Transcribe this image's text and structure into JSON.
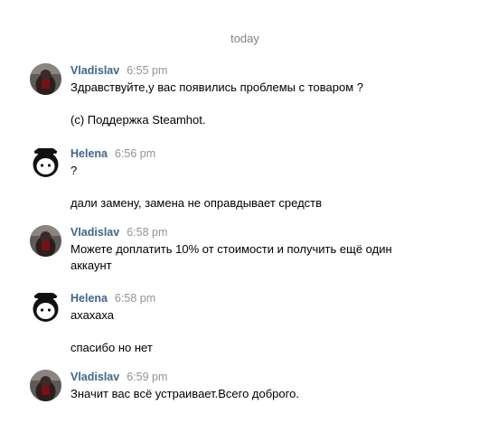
{
  "date_separator": "today",
  "messages": [
    {
      "author": "Vladislav",
      "avatar": "vladislav-avatar",
      "time": "6:55 pm",
      "lines": [
        "Здравствуйте,у вас появились проблемы с товаром ?",
        "(c) Поддержка Steamhot."
      ]
    },
    {
      "author": "Helena",
      "avatar": "helena-avatar",
      "time": "6:56 pm",
      "lines": [
        "?",
        "дали замену, замена не оправдывает средств"
      ]
    },
    {
      "author": "Vladislav",
      "avatar": "vladislav-avatar",
      "time": "6:58 pm",
      "lines": [
        "Можете доплатить 10% от стоимости и получить ещё один",
        "аккаунт"
      ]
    },
    {
      "author": "Helena",
      "avatar": "helena-avatar",
      "time": "6:58 pm",
      "lines": [
        "ахахаха",
        "спасибо но нет"
      ]
    },
    {
      "author": "Vladislav",
      "avatar": "vladislav-avatar",
      "time": "6:59 pm",
      "lines": [
        "Значит вас всё устраивает.Всего доброго."
      ]
    }
  ]
}
